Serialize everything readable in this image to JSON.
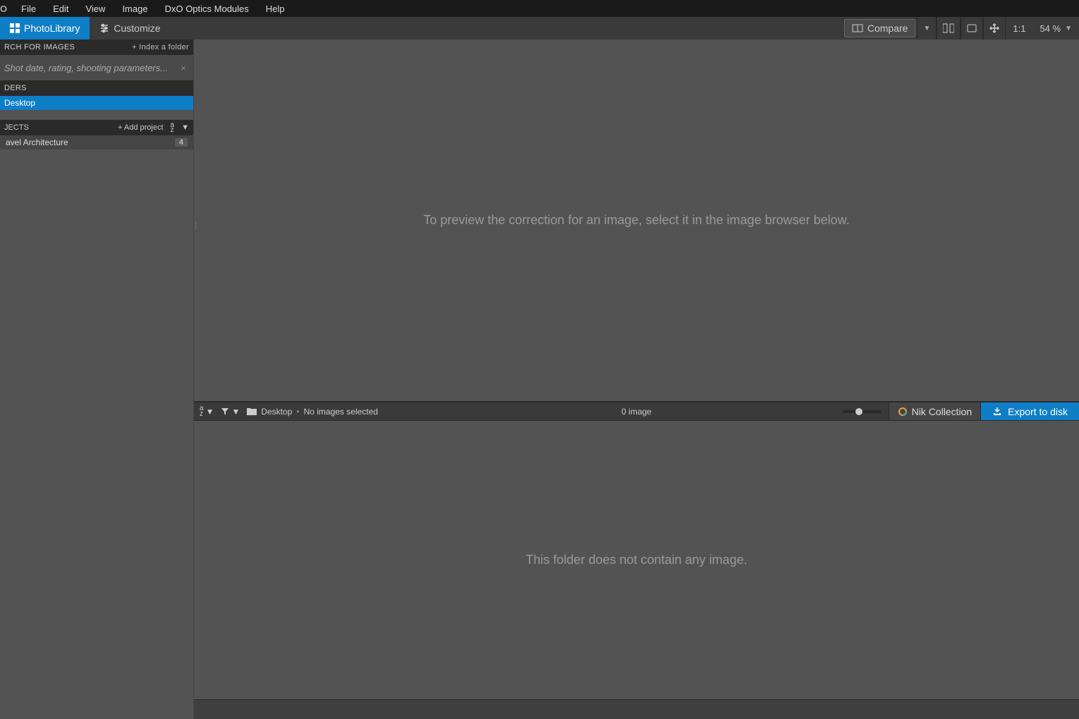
{
  "menu": {
    "logo": "O",
    "items": [
      "File",
      "Edit",
      "View",
      "Image",
      "DxO Optics Modules",
      "Help"
    ]
  },
  "modebar": {
    "photolibrary": "PhotoLibrary",
    "customize": "Customize",
    "compare": "Compare",
    "ratio_label": "1:1",
    "zoom": "54 %"
  },
  "sidebar": {
    "search_header": "RCH FOR IMAGES",
    "index_action": "+ Index a folder",
    "search_placeholder": "Shot date, rating, shooting parameters...",
    "folders_header": "DERS",
    "folder_name": "Desktop",
    "projects_header": "JECTS",
    "add_project": "+ Add project",
    "project_name": "avel Architecture",
    "project_count": "4"
  },
  "preview": {
    "message": "To preview the correction for an image, select it in the image browser below."
  },
  "browser_bar": {
    "folder": "Desktop",
    "status": "No images selected",
    "count": "0 image",
    "nik": "Nik Collection",
    "export": "Export to disk"
  },
  "browser": {
    "message": "This folder does not contain any image."
  }
}
